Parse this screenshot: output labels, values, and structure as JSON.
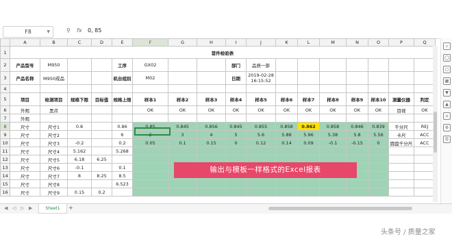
{
  "formula_bar": {
    "cell_ref": "F8",
    "fx_label": "fx",
    "value": "0, 85"
  },
  "columns": [
    "A",
    "B",
    "C",
    "D",
    "E",
    "F",
    "G",
    "H",
    "I",
    "J",
    "K",
    "L",
    "M",
    "N",
    "O",
    "P",
    "Q"
  ],
  "row_numbers": [
    "1",
    "2",
    "3",
    "4",
    "5",
    "6",
    "7",
    "8",
    "9",
    "10",
    "11",
    "12",
    "13",
    "14",
    "15",
    "16"
  ],
  "sheet": {
    "title": "首件检验表",
    "r2": {
      "product_no_label": "产品型号",
      "product_no": "M950",
      "process_label": "工序",
      "process": "GX02",
      "dept_label": "部门",
      "dept": "品质一部"
    },
    "r3": {
      "product_name_label": "产品名称",
      "product_name": "M950成品",
      "machine_label": "机台组别",
      "machine": "M02",
      "date_label": "日期",
      "date": "2019-02-28",
      "time": "16:15:52"
    },
    "headers": [
      "项目",
      "检测项目",
      "规格下限",
      "目标值",
      "规格上限",
      "样本1",
      "样本2",
      "样本3",
      "样本4",
      "样本5",
      "样本6",
      "样本7",
      "样本8",
      "样本9",
      "样本10",
      "测量仪器",
      "判定"
    ],
    "r6": [
      "外观",
      "黑点",
      "",
      "",
      "",
      "OK",
      "OK",
      "OK",
      "OK",
      "OK",
      "OK",
      "OK",
      "OK",
      "OK",
      "OK",
      "目视",
      "OK"
    ],
    "r7": [
      "外观",
      "",
      "",
      "",
      "",
      "",
      "",
      "",
      "",
      "",
      "",
      "",
      "",
      "",
      "",
      "",
      ""
    ],
    "r8": [
      "尺寸",
      "尺寸1",
      "0.8",
      "",
      "0.86",
      "0.85",
      "0.845",
      "0.856",
      "0.845",
      "0.855",
      "0.858",
      "0.862",
      "0.858",
      "0.846",
      "0.839",
      "千分尺",
      "REJ"
    ],
    "r9": [
      "尺寸",
      "尺寸2",
      "",
      "",
      "6",
      "2",
      "3",
      "4",
      "5",
      "5.6",
      "5.88",
      "5.96",
      "5.38",
      "5.8",
      "5.56",
      "卡尺",
      "ACC"
    ],
    "r10": [
      "尺寸",
      "尺寸3",
      "-0.2",
      "",
      "0.2",
      "0.05",
      "0.1",
      "0.15",
      "0",
      "0.12",
      "0.14",
      "0.09",
      "-0.1",
      "-0.15",
      "0",
      "圆盘千分尺",
      "ACC"
    ],
    "r11": [
      "尺寸",
      "尺寸4",
      "5.162",
      "",
      "5.268"
    ],
    "r12": [
      "尺寸",
      "尺寸5",
      "6.18",
      "6.25",
      ""
    ],
    "r13": [
      "尺寸",
      "尺寸6",
      "-0.1",
      "",
      "0.1"
    ],
    "r14": [
      "尺寸",
      "尺寸7",
      "8",
      "8.25",
      "8.5"
    ],
    "r15": [
      "尺寸",
      "尺寸8",
      "",
      "",
      "6.523"
    ],
    "r16": [
      "尺寸",
      "尺寸9",
      "0.15",
      "0.2",
      ""
    ]
  },
  "sheet_tab": "Sheet1",
  "add_sheet": "+",
  "banner_text": "输出与模板一样格式的Excel报表",
  "watermark": "头条号 / 质量之家"
}
